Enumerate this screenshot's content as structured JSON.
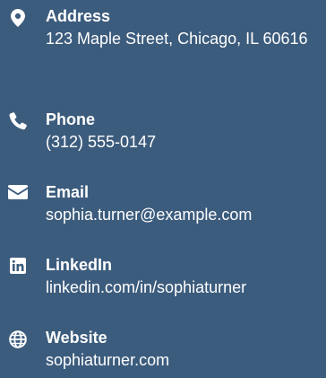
{
  "colors": {
    "background": "#3c5c7d",
    "text": "#ffffff"
  },
  "contacts": [
    {
      "icon": "map-pin-icon",
      "label": "Address",
      "value": "123 Maple Street, Chicago, IL 60616"
    },
    {
      "icon": "phone-icon",
      "label": "Phone",
      "value": "(312) 555-0147"
    },
    {
      "icon": "envelope-icon",
      "label": "Email",
      "value": "sophia.turner@example.com"
    },
    {
      "icon": "linkedin-icon",
      "label": "LinkedIn",
      "value": "linkedin.com/in/sophiaturner"
    },
    {
      "icon": "globe-icon",
      "label": "Website",
      "value": "sophiaturner.com"
    }
  ]
}
